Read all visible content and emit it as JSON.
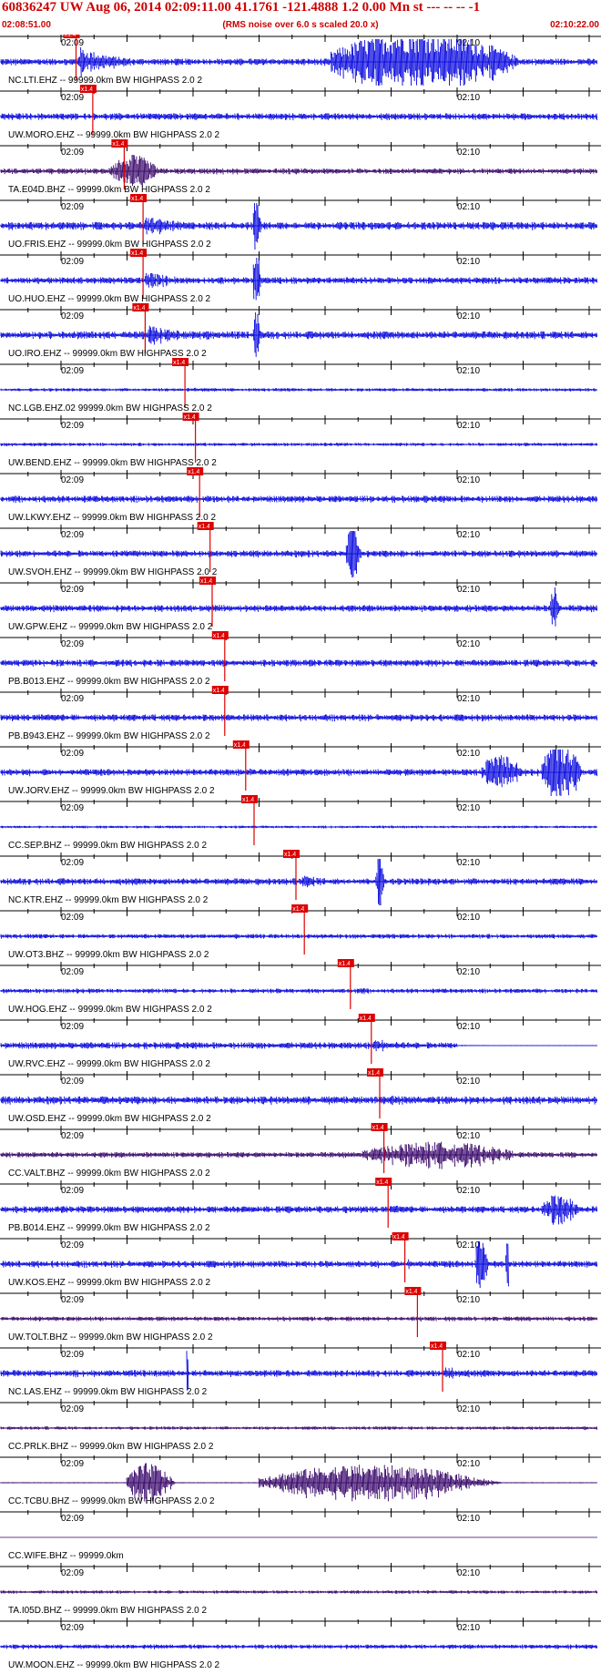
{
  "header": {
    "title": "60836247 UW Aug 06, 2014 02:09:11.00   41.1761 -121.4888  1.2 0.00 Mn st --- -- --   -1",
    "start_time": "02:08:51.00",
    "end_time": "02:10:22.00",
    "noise_note": "(RMS noise over 6.0 s scaled 20.0 x)"
  },
  "time_labels": [
    "02:09",
    "02:10"
  ],
  "pick_label": "x1.4",
  "colors": {
    "trace_blue": "#0000dd",
    "trace_dark": "#330066",
    "pick_red": "#dd0000",
    "axis": "#000000"
  },
  "traces": [
    {
      "label": "NC.LTI.EHZ -- 99999.0km BW  HIGHPASS  2.0  2",
      "amp": 0.3,
      "burst": 8.5,
      "pick": 0.75,
      "color": "blue",
      "bursts": [
        {
          "s": 0.55,
          "e": 0.99,
          "a": 1.0
        }
      ]
    },
    {
      "label": "UW.MORO.EHZ -- 99999.0km BW  HIGHPASS  2.0  2",
      "amp": 0.3,
      "burst": 1.2,
      "pick": 1.15,
      "color": "blue",
      "bursts": []
    },
    {
      "label": "TA.E04D.BHZ -- 99999.0km BW  HIGHPASS  2.0  2",
      "amp": 0.25,
      "burst": 1.2,
      "pick": 1.9,
      "color": "dark",
      "bursts": [
        {
          "s": 0.18,
          "e": 0.3,
          "a": 0.5
        }
      ]
    },
    {
      "label": "UO.FRIS.EHZ -- 99999.0km BW  HIGHPASS  2.0  2",
      "amp": 0.35,
      "burst": 5.0,
      "pick": 2.35,
      "color": "blue",
      "bursts": [
        {
          "s": 0.42,
          "e": 0.44,
          "a": 1.0
        }
      ]
    },
    {
      "label": "UO.HUO.EHZ -- 99999.0km BW  HIGHPASS  2.0  2",
      "amp": 0.3,
      "burst": 5.0,
      "pick": 2.35,
      "color": "blue",
      "bursts": [
        {
          "s": 0.42,
          "e": 0.44,
          "a": 1.0
        }
      ]
    },
    {
      "label": "UO.IRO.EHZ -- 99999.0km BW  HIGHPASS  2.0  2",
      "amp": 0.35,
      "burst": 5.0,
      "pick": 2.4,
      "color": "blue",
      "bursts": [
        {
          "s": 0.42,
          "e": 0.44,
          "a": 1.0
        }
      ]
    },
    {
      "label": "NC.LGB.EHZ.02 99999.0km BW  HIGHPASS  2.0  2",
      "amp": 0.15,
      "burst": 3.0,
      "pick": 3.35,
      "color": "blue",
      "bursts": []
    },
    {
      "label": "UW.BEND.EHZ -- 99999.0km BW  HIGHPASS  2.0  2",
      "amp": 0.15,
      "burst": 1.0,
      "pick": 3.6,
      "color": "blue",
      "bursts": []
    },
    {
      "label": "UW.LKWY.EHZ -- 99999.0km BW  HIGHPASS  2.0  2",
      "amp": 0.3,
      "burst": 2.5,
      "pick": 3.7,
      "color": "blue",
      "bursts": []
    },
    {
      "label": "UW.SVOH.EHZ -- 99999.0km BW  HIGHPASS  2.0  2",
      "amp": 0.3,
      "burst": 2.0,
      "pick": 3.95,
      "color": "blue",
      "bursts": [
        {
          "s": 0.575,
          "e": 0.61,
          "a": 0.9
        }
      ]
    },
    {
      "label": "UW.GPW.EHZ -- 99999.0km BW  HIGHPASS  2.0  2",
      "amp": 0.3,
      "burst": 2.5,
      "pick": 4.0,
      "color": "blue",
      "bursts": [
        {
          "s": 0.915,
          "e": 0.935,
          "a": 0.8
        }
      ]
    },
    {
      "label": "PB.B013.EHZ -- 99999.0km BW  HIGHPASS  2.0  2",
      "amp": 0.3,
      "burst": 2.0,
      "pick": 4.3,
      "color": "blue",
      "bursts": []
    },
    {
      "label": "PB.B943.EHZ -- 99999.0km BW  HIGHPASS  2.0  2",
      "amp": 0.3,
      "burst": 2.0,
      "pick": 4.3,
      "color": "blue",
      "bursts": []
    },
    {
      "label": "UW.JORV.EHZ -- 99999.0km BW  HIGHPASS  2.0  2",
      "amp": 0.3,
      "burst": 2.5,
      "pick": 4.8,
      "color": "blue",
      "bursts": [
        {
          "s": 0.8,
          "e": 0.9,
          "a": 0.6
        },
        {
          "s": 0.9,
          "e": 0.995,
          "a": 1.0
        }
      ]
    },
    {
      "label": "CC.SEP.BHZ -- 99999.0km BW  HIGHPASS  2.0  2",
      "amp": 0.12,
      "burst": 1.0,
      "pick": 5.0,
      "color": "blue",
      "bursts": []
    },
    {
      "label": "NC.KTR.EHZ -- 99999.0km BW  HIGHPASS  2.0  2",
      "amp": 0.3,
      "burst": 4.0,
      "pick": 6.0,
      "color": "blue",
      "bursts": [
        {
          "s": 0.625,
          "e": 0.645,
          "a": 1.0
        }
      ]
    },
    {
      "label": "UW.OT3.BHZ -- 99999.0km BW  HIGHPASS  2.0  2",
      "amp": 0.2,
      "burst": 2.0,
      "pick": 6.2,
      "color": "blue",
      "bursts": []
    },
    {
      "label": "UW.HOG.EHZ -- 99999.0km BW  HIGHPASS  2.0  2",
      "amp": 0.2,
      "burst": 3.0,
      "pick": 7.3,
      "color": "blue",
      "bursts": []
    },
    {
      "label": "UW.RVC.EHZ -- 99999.0km BW  HIGHPASS  2.0  2",
      "amp": 0.3,
      "burst": 4.0,
      "pick": 7.8,
      "color": "blue",
      "bursts": [],
      "flat_after": 0.74
    },
    {
      "label": "UW.OSD.EHZ -- 99999.0km BW  HIGHPASS  2.0  2",
      "amp": 0.35,
      "burst": 3.0,
      "pick": 8.0,
      "color": "blue",
      "bursts": []
    },
    {
      "label": "CC.VALT.BHZ -- 99999.0km BW  HIGHPASS  2.0  2",
      "amp": 0.25,
      "burst": 4.0,
      "pick": 8.1,
      "color": "dark",
      "bursts": [
        {
          "s": 0.6,
          "e": 0.98,
          "a": 0.4
        }
      ]
    },
    {
      "label": "PB.B014.EHZ -- 99999.0km BW  HIGHPASS  2.0  2",
      "amp": 0.3,
      "burst": 2.5,
      "pick": 8.2,
      "color": "blue",
      "bursts": [
        {
          "s": 0.9,
          "e": 0.99,
          "a": 0.5
        }
      ]
    },
    {
      "label": "UW.KOS.EHZ -- 99999.0km BW  HIGHPASS  2.0  2",
      "amp": 0.3,
      "burst": 3.0,
      "pick": 8.6,
      "color": "blue",
      "bursts": [
        {
          "s": 0.79,
          "e": 0.82,
          "a": 1.0
        },
        {
          "s": 0.84,
          "e": 0.85,
          "a": 1.0
        }
      ]
    },
    {
      "label": "UW.TOLT.BHZ -- 99999.0km BW  HIGHPASS  2.0  2",
      "amp": 0.2,
      "burst": 1.0,
      "pick": 8.9,
      "color": "dark",
      "bursts": []
    },
    {
      "label": "NC.LAS.EHZ -- 99999.0km BW  HIGHPASS  2.0  2",
      "amp": 0.3,
      "burst": 4.0,
      "pick": 9.5,
      "color": "blue",
      "bursts": [
        {
          "s": 0.31,
          "e": 0.315,
          "a": 1.0
        }
      ]
    },
    {
      "label": "CC.PRLK.BHZ -- 99999.0km BW  HIGHPASS  2.0  2",
      "amp": 0.15,
      "burst": 1.0,
      "pick": -1,
      "color": "dark",
      "bursts": []
    },
    {
      "label": "CC.TCBU.BHZ -- 99999.0km BW  HIGHPASS  2.0  2",
      "amp": 0.05,
      "burst": 1.0,
      "pick": -1,
      "color": "dark",
      "bursts": [
        {
          "s": 0.21,
          "e": 0.32,
          "a": 0.6
        },
        {
          "s": 0.43,
          "e": 0.975,
          "a": 0.55
        }
      ]
    },
    {
      "label": "CC.WIFE.BHZ -- 99999.0km",
      "amp": 0.0,
      "burst": 1.0,
      "pick": -1,
      "color": "dark",
      "bursts": []
    },
    {
      "label": "TA.I05D.BHZ -- 99999.0km BW  HIGHPASS  2.0  2",
      "amp": 0.15,
      "burst": 1.0,
      "pick": -1,
      "color": "dark",
      "bursts": []
    },
    {
      "label": "UW.MOON.EHZ -- 99999.0km BW  HIGHPASS  2.0  2",
      "amp": 0.2,
      "burst": 1.0,
      "pick": -1,
      "color": "blue",
      "bursts": []
    }
  ]
}
